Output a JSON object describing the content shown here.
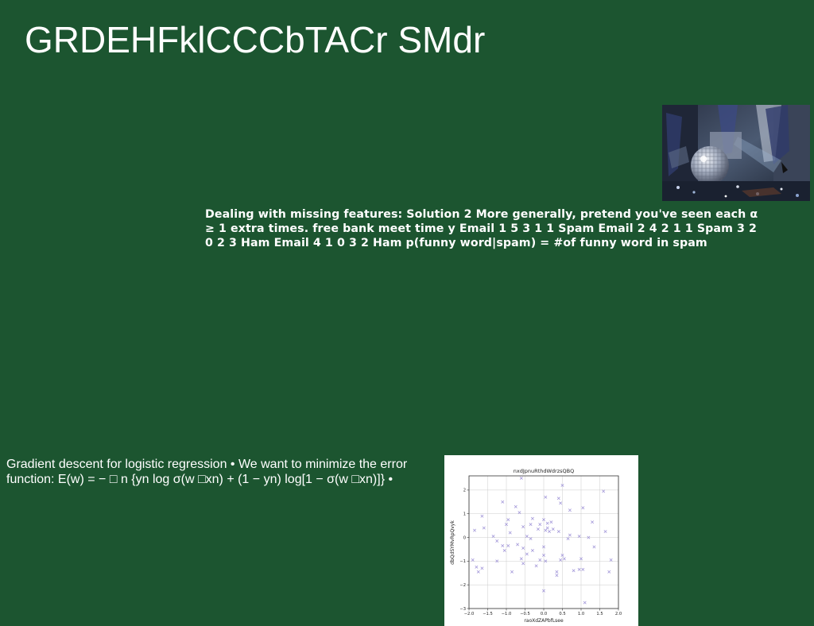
{
  "slide": {
    "title": "GRDEHFklCCCbTACr SMdr",
    "missing_features_text": "Dealing with missing features: Solution 2 More generally, pretend you've seen each α ≥ 1 extra times. free bank meet time y Email 1 5 3 1 1 Spam Email 2 4 2 1 1 Spam 3 2 0 2 3 Ham Email 4 1 0 3 2 Ham p(funny word|spam) = #of funny word in spam",
    "gradient_text": "Gradient descent for logistic regression • We want to minimize the error function: E(w) = − □ n {yn log σ(w □xn) + (1 − yn) log[1 − σ(w □xn)]} •"
  },
  "colors": {
    "background": "#1c5530",
    "text": "#ffffff",
    "marker": "#9b8fd6"
  },
  "icons": {
    "photo": "disco-ball-photo"
  },
  "chart_data": {
    "type": "scatter",
    "title": "nxdJpnuRthdWdrzsQBQ",
    "xlabel": "raoXdZAPbfLsee",
    "ylabel": "dbQdSYMvRpQvyk",
    "xlim": [
      -2.0,
      2.0
    ],
    "ylim": [
      -3.0,
      2.6
    ],
    "x_ticks": [
      "−2.0",
      "−1.5",
      "−1.0",
      "−0.5",
      "0.0",
      "0.5",
      "1.0",
      "1.5",
      "2.0"
    ],
    "x_tick_values": [
      -2.0,
      -1.5,
      -1.0,
      -0.5,
      0.0,
      0.5,
      1.0,
      1.5,
      2.0
    ],
    "y_ticks": [
      "2",
      "1",
      "0",
      "−1",
      "−2",
      "−3"
    ],
    "y_tick_values": [
      2,
      1,
      0,
      -1,
      -2,
      -3
    ],
    "grid": true,
    "marker": "x",
    "points": [
      [
        -0.6,
        2.5
      ],
      [
        0.5,
        2.2
      ],
      [
        1.6,
        1.95
      ],
      [
        0.05,
        1.7
      ],
      [
        0.4,
        1.65
      ],
      [
        0.45,
        1.45
      ],
      [
        -1.1,
        1.5
      ],
      [
        -1.65,
        0.9
      ],
      [
        -0.75,
        1.3
      ],
      [
        -0.95,
        0.75
      ],
      [
        -1.0,
        0.55
      ],
      [
        -0.65,
        1.05
      ],
      [
        -0.35,
        0.55
      ],
      [
        -0.15,
        0.35
      ],
      [
        -0.55,
        0.45
      ],
      [
        0.0,
        0.75
      ],
      [
        0.1,
        0.6
      ],
      [
        0.2,
        0.65
      ],
      [
        0.1,
        0.4
      ],
      [
        0.25,
        0.35
      ],
      [
        0.05,
        0.3
      ],
      [
        0.15,
        0.25
      ],
      [
        0.4,
        0.25
      ],
      [
        0.7,
        1.15
      ],
      [
        1.05,
        1.25
      ],
      [
        1.3,
        0.65
      ],
      [
        -1.85,
        0.3
      ],
      [
        -1.6,
        0.4
      ],
      [
        -1.35,
        0.05
      ],
      [
        -0.9,
        0.2
      ],
      [
        -0.45,
        0.05
      ],
      [
        -0.1,
        0.55
      ],
      [
        -0.35,
        -0.05
      ],
      [
        0.7,
        0.1
      ],
      [
        0.95,
        0.05
      ],
      [
        1.2,
        0.0
      ],
      [
        -1.25,
        -0.15
      ],
      [
        -1.1,
        -0.35
      ],
      [
        -1.05,
        -0.55
      ],
      [
        -0.7,
        -0.3
      ],
      [
        -0.55,
        -0.45
      ],
      [
        -0.3,
        -0.55
      ],
      [
        -0.45,
        -0.7
      ],
      [
        0.0,
        -0.4
      ],
      [
        0.65,
        -0.05
      ],
      [
        1.35,
        -0.4
      ],
      [
        -0.95,
        -0.35
      ],
      [
        0.5,
        -0.75
      ],
      [
        -1.9,
        -0.95
      ],
      [
        -1.8,
        -1.25
      ],
      [
        -1.75,
        -1.45
      ],
      [
        -1.65,
        -1.3
      ],
      [
        -1.25,
        -1.0
      ],
      [
        -0.6,
        -0.9
      ],
      [
        -0.55,
        -1.1
      ],
      [
        0.0,
        -0.75
      ],
      [
        0.05,
        -1.0
      ],
      [
        0.45,
        -0.95
      ],
      [
        0.35,
        -1.45
      ],
      [
        0.35,
        -1.6
      ],
      [
        0.8,
        -1.4
      ],
      [
        0.95,
        -1.35
      ],
      [
        1.05,
        -1.35
      ],
      [
        1.0,
        -0.9
      ],
      [
        1.75,
        -1.45
      ],
      [
        1.8,
        -0.95
      ],
      [
        -0.85,
        -1.45
      ],
      [
        -0.2,
        -1.2
      ],
      [
        -0.1,
        -0.95
      ],
      [
        0.0,
        -2.25
      ],
      [
        1.1,
        -2.75
      ],
      [
        1.65,
        0.25
      ],
      [
        -0.3,
        0.8
      ],
      [
        0.55,
        -0.9
      ]
    ]
  }
}
